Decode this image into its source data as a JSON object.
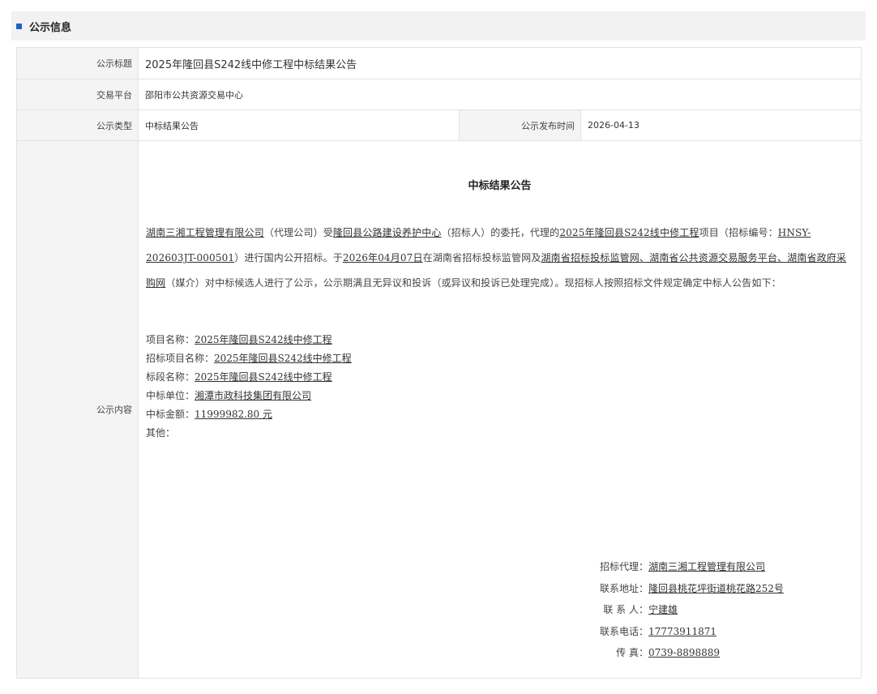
{
  "section": {
    "title": "公示信息"
  },
  "fields": {
    "title_label": "公示标题",
    "title_value": "2025年隆回县S242线中修工程中标结果公告",
    "platform_label": "交易平台",
    "platform_value": "邵阳市公共资源交易中心",
    "type_label": "公示类型",
    "type_value": "中标结果公告",
    "time_label": "公示发布时间",
    "time_value": "2026-04-13",
    "content_label": "公示内容"
  },
  "content": {
    "heading": "中标结果公告",
    "para": {
      "agency": "湖南三湘工程管理有限公司",
      "t1": "（代理公司）受",
      "tenderer": "隆回县公路建设养护中心",
      "t2": "（招标人）的委托，代理的",
      "project": "2025年隆回县S242线中修工程",
      "t3": "项目（招标编号：",
      "code": "HNSY-202603JT-000501",
      "t4": "）进行国内公开招标。于",
      "date": "2026年04月07日",
      "t5": "在湖南省招标投标监管网及",
      "media": "湖南省招标投标监管网、湖南省公共资源交易服务平台、湖南省政府采购网",
      "t6": "（媒介）对中标候选人进行了公示，公示期满且无异议和投诉（或异议和投诉已处理完成）。现招标人按照招标文件规定确定中标人公告如下："
    },
    "details": {
      "project_name_label": "项目名称：",
      "project_name": "2025年隆回县S242线中修工程",
      "bid_project_label": "招标项目名称：",
      "bid_project": "2025年隆回县S242线中修工程",
      "section_label": "标段名称：",
      "section_name": "2025年隆回县S242线中修工程",
      "winner_label": "中标单位：",
      "winner": "湘潭市政科技集团有限公司",
      "amount_label": "中标金额：",
      "amount": "11999982.80 元",
      "other_label": "其他："
    },
    "contact": {
      "agent_label": "招标代理：",
      "agent": "湖南三湘工程管理有限公司",
      "address_label": "联系地址：",
      "address": "隆回县桃花坪街道桃花路252号",
      "person_label": "联 系 人：",
      "person": "宁建雄",
      "phone_label": "联系电话：",
      "phone": "17773911871",
      "fax_label": "传 真：",
      "fax": "0739-8898889"
    }
  }
}
